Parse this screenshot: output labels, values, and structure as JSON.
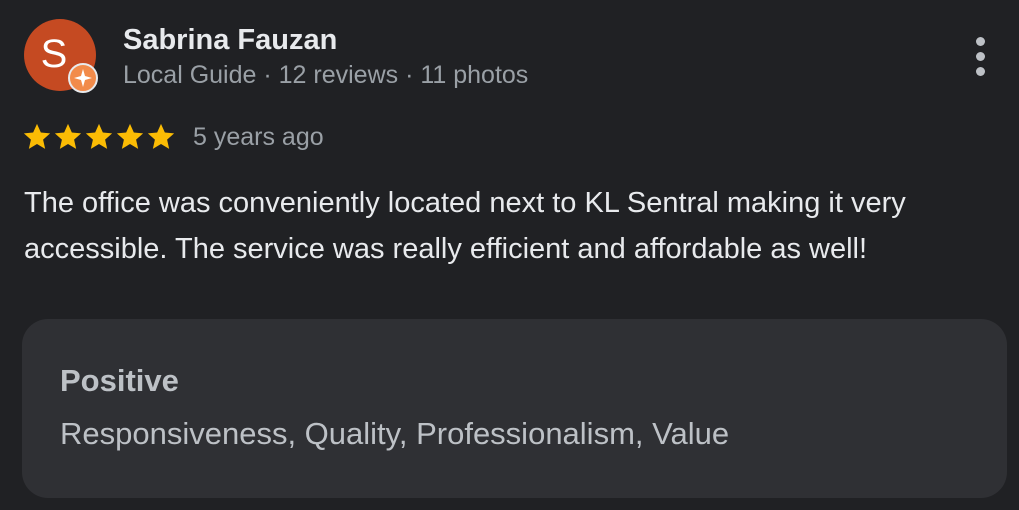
{
  "review": {
    "author": {
      "initial": "S",
      "name": "Sabrina Fauzan",
      "meta": "Local Guide · 12 reviews · 11 photos",
      "avatar_color": "#c54a22",
      "badge_icon": "local-guide-star-icon"
    },
    "rating": {
      "stars": 5,
      "max_stars": 5,
      "star_color": "#fbbc04"
    },
    "date": "5 years ago",
    "text": "The office was conveniently located next to KL Sentral making it very accessible. The service was really efficient and affordable as well!",
    "summary": {
      "heading": "Positive",
      "values": "Responsiveness, Quality, Professionalism, Value"
    },
    "more_icon": "more-vertical-icon"
  }
}
